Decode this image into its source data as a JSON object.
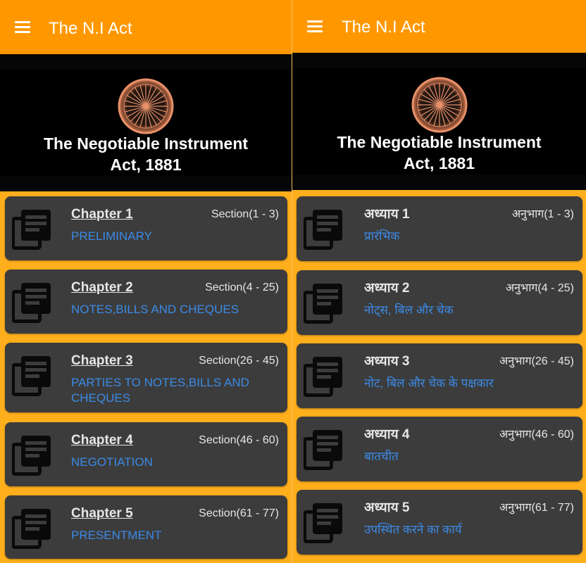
{
  "left": {
    "appbar": {
      "title": "The N.I Act"
    },
    "banner": {
      "line1": "The Negotiable Instrument",
      "line2": "Act, 1881"
    },
    "chapters": [
      {
        "title": "Chapter 1",
        "range": "Section(1 - 3)",
        "desc": "PRELIMINARY"
      },
      {
        "title": "Chapter 2",
        "range": "Section(4 - 25)",
        "desc": "NOTES,BILLS AND CHEQUES"
      },
      {
        "title": "Chapter 3",
        "range": "Section(26 - 45)",
        "desc": "PARTIES TO NOTES,BILLS AND CHEQUES"
      },
      {
        "title": "Chapter 4",
        "range": "Section(46 - 60)",
        "desc": "NEGOTIATION"
      },
      {
        "title": "Chapter 5",
        "range": "Section(61 - 77)",
        "desc": "PRESENTMENT"
      }
    ]
  },
  "right": {
    "appbar": {
      "title": "The N.I Act"
    },
    "banner": {
      "line1": "The Negotiable Instrument",
      "line2": "Act, 1881"
    },
    "chapters": [
      {
        "title": "अध्याय 1",
        "range": "अनुभाग(1 - 3)",
        "desc": "प्रारंभिक"
      },
      {
        "title": "अध्याय 2",
        "range": "अनुभाग(4 - 25)",
        "desc": "नोट्स, बिल और चेक"
      },
      {
        "title": "अध्याय 3",
        "range": "अनुभाग(26 - 45)",
        "desc": "नोट, बिल और चेक के पक्षकार"
      },
      {
        "title": "अध्याय 4",
        "range": "अनुभाग(46 - 60)",
        "desc": "बातचीत"
      },
      {
        "title": "अध्याय 5",
        "range": "अनुभाग(61 - 77)",
        "desc": "उपस्थित करने का कार्य"
      }
    ]
  },
  "colors": {
    "appbar": "#ff9800",
    "background": "#ffae1c",
    "card": "#3c3c3c",
    "link": "#3b8ae6",
    "banner": "#000000",
    "emblem_ring": "#e8916a"
  },
  "icons": {
    "menu": "menu-icon",
    "chapter": "library-books-icon",
    "emblem": "ashoka-chakra-emblem"
  }
}
